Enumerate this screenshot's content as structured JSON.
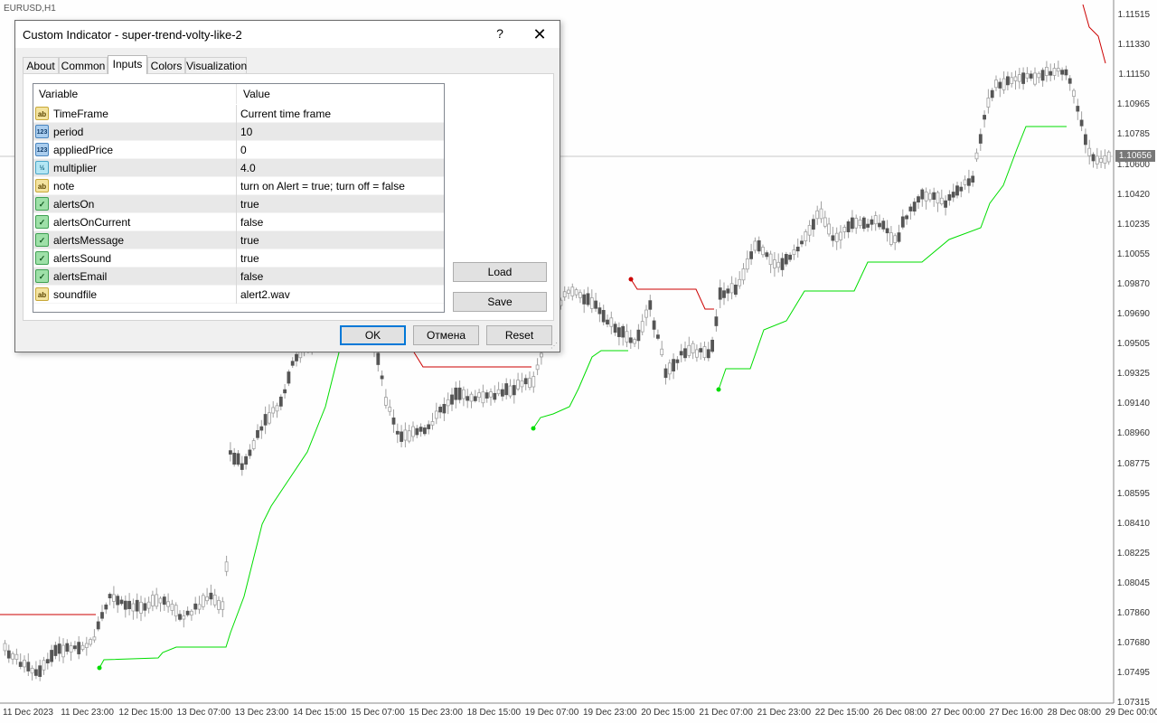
{
  "chart": {
    "symbol": "EURUSD,H1",
    "current_price": "1.10656",
    "price_labels": [
      "1.11515",
      "1.11330",
      "1.11150",
      "1.10965",
      "1.10785",
      "1.10600",
      "1.10420",
      "1.10235",
      "1.10055",
      "1.09870",
      "1.09690",
      "1.09505",
      "1.09325",
      "1.09140",
      "1.08960",
      "1.08775",
      "1.08595",
      "1.08410",
      "1.08225",
      "1.08045",
      "1.07860",
      "1.07680",
      "1.07495",
      "1.07315"
    ],
    "time_labels": [
      "11 Dec 2023",
      "11 Dec 23:00",
      "12 Dec 15:00",
      "13 Dec 07:00",
      "13 Dec 23:00",
      "14 Dec 15:00",
      "15 Dec 07:00",
      "15 Dec 23:00",
      "18 Dec 15:00",
      "19 Dec 07:00",
      "19 Dec 23:00",
      "20 Dec 15:00",
      "21 Dec 07:00",
      "21 Dec 23:00",
      "22 Dec 15:00",
      "26 Dec 08:00",
      "27 Dec 00:00",
      "27 Dec 16:00",
      "28 Dec 08:00",
      "29 Dec 00:00"
    ],
    "up_color": "#00dd00",
    "down_color": "#cc0000",
    "candle_color": "#a0a0a0"
  },
  "dialog": {
    "title": "Custom Indicator - super-trend-volty-like-2",
    "help": "?",
    "close": "✕",
    "tabs": [
      "About",
      "Common",
      "Inputs",
      "Colors",
      "Visualization"
    ],
    "active_tab": "Inputs",
    "columns": {
      "variable": "Variable",
      "value": "Value"
    },
    "rows": [
      {
        "icon": "ab",
        "name": "TimeFrame",
        "value": "Current time frame"
      },
      {
        "icon": "123",
        "name": "period",
        "value": "10"
      },
      {
        "icon": "123",
        "name": "appliedPrice",
        "value": "0"
      },
      {
        "icon": "v2",
        "name": "multiplier",
        "value": "4.0"
      },
      {
        "icon": "ab",
        "name": "note",
        "value": "turn on Alert = true; turn off = false"
      },
      {
        "icon": "bool",
        "name": "alertsOn",
        "value": "true"
      },
      {
        "icon": "bool",
        "name": "alertsOnCurrent",
        "value": "false"
      },
      {
        "icon": "bool",
        "name": "alertsMessage",
        "value": "true"
      },
      {
        "icon": "bool",
        "name": "alertsSound",
        "value": "true"
      },
      {
        "icon": "bool",
        "name": "alertsEmail",
        "value": "false"
      },
      {
        "icon": "ab",
        "name": "soundfile",
        "value": "alert2.wav"
      }
    ],
    "buttons": {
      "load": "Load",
      "save": "Save",
      "ok": "OK",
      "cancel": "Отмена",
      "reset": "Reset"
    }
  }
}
